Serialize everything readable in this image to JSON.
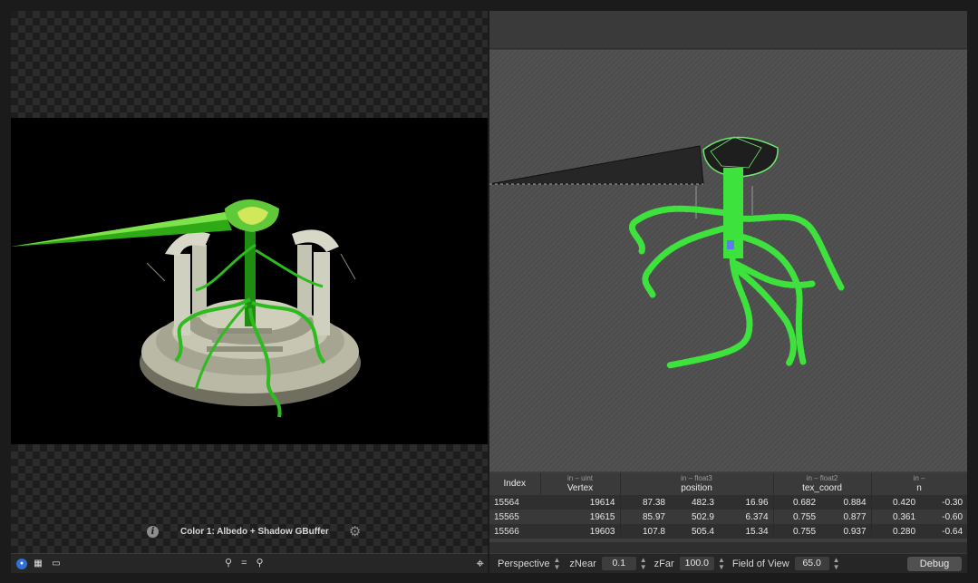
{
  "texture_viewer": {
    "attachment_label": "Color 1: Albedo + Shadow GBuffer"
  },
  "toolbar_left": {
    "search_glyph": "⚲",
    "menu_glyph": "=",
    "zoom_glyph": "🔍"
  },
  "buffer_table": {
    "columns": [
      {
        "sub": "",
        "main": "Index"
      },
      {
        "sub": "in – uint",
        "main": "Vertex"
      },
      {
        "sub": "in – float3",
        "main": "position"
      },
      {
        "sub": "in – float2",
        "main": "tex_coord"
      },
      {
        "sub": "in –",
        "main": "n"
      }
    ],
    "rows": [
      {
        "index": "15564",
        "vertex": "19614",
        "px": "87.38",
        "py": "482.3",
        "pz": "16.96",
        "u": "0.682",
        "v": "0.884",
        "n1": "0.420",
        "n2": "-0.30"
      },
      {
        "index": "15565",
        "vertex": "19615",
        "px": "85.97",
        "py": "502.9",
        "pz": "6.374",
        "u": "0.755",
        "v": "0.877",
        "n1": "0.361",
        "n2": "-0.60"
      },
      {
        "index": "15566",
        "vertex": "19603",
        "px": "107.8",
        "py": "505.4",
        "pz": "15.34",
        "u": "0.755",
        "v": "0.937",
        "n1": "0.280",
        "n2": "-0.64"
      }
    ]
  },
  "camera_toolbar": {
    "projection": "Perspective",
    "znear_label": "zNear",
    "znear_value": "0.1",
    "zfar_label": "zFar",
    "zfar_value": "100.0",
    "fov_label": "Field of View",
    "fov_value": "65.0",
    "debug_label": "Debug"
  }
}
